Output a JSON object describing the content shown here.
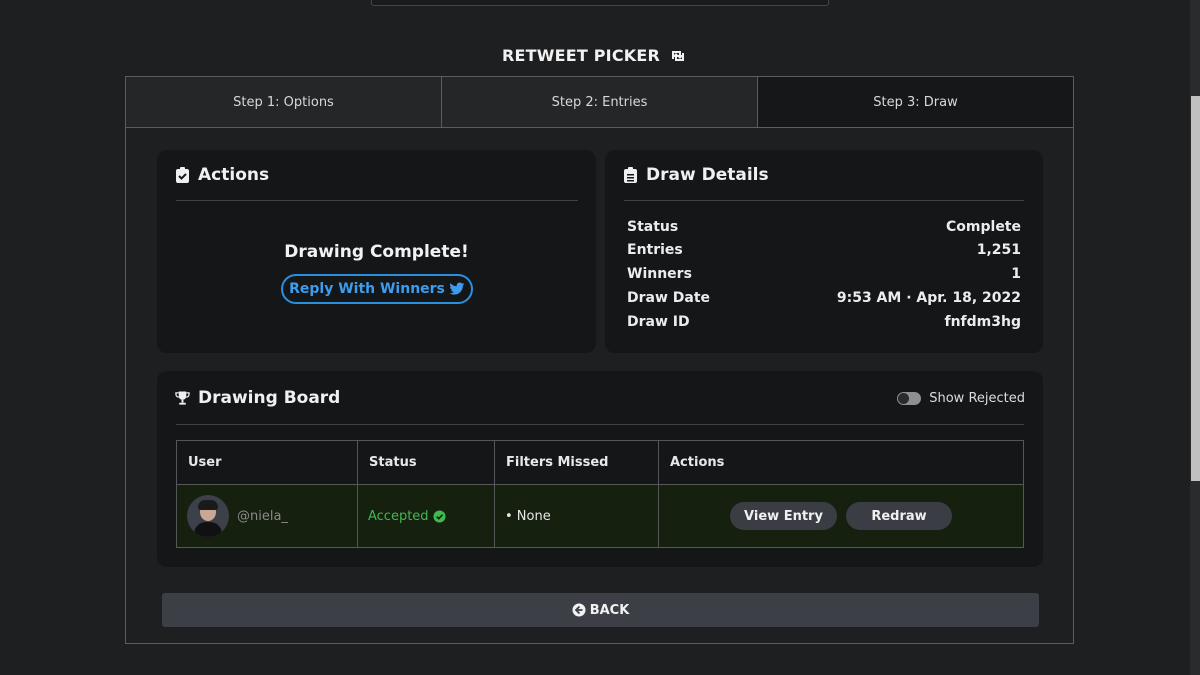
{
  "page_title": "RETWEET PICKER",
  "tabs": [
    "Step 1: Options",
    "Step 2: Entries",
    "Step 3: Draw"
  ],
  "actions": {
    "title": "Actions",
    "message": "Drawing Complete!",
    "reply_button": "Reply With Winners"
  },
  "details": {
    "title": "Draw Details",
    "rows": [
      {
        "label": "Status",
        "value": "Complete"
      },
      {
        "label": "Entries",
        "value": "1,251"
      },
      {
        "label": "Winners",
        "value": "1"
      },
      {
        "label": "Draw Date",
        "value": "9:53 AM · Apr. 18, 2022"
      },
      {
        "label": "Draw ID",
        "value": "fnfdm3hg"
      }
    ]
  },
  "board": {
    "title": "Drawing Board",
    "toggle_label": "Show Rejected",
    "columns": [
      "User",
      "Status",
      "Filters Missed",
      "Actions"
    ],
    "rows": [
      {
        "user": "@niela_",
        "status": "Accepted",
        "filters": "• None",
        "view_button": "View Entry",
        "redraw_button": "Redraw"
      }
    ]
  },
  "back_button": "BACK",
  "colors": {
    "accent": "#2b8fe0",
    "accepted": "#3fb950",
    "background": "#1e1f21",
    "card": "#151617"
  },
  "icons": {
    "title": "retweet-icon",
    "actions": "clipboard-check-icon",
    "details": "clipboard-list-icon",
    "board": "trophy-icon",
    "reply": "twitter-icon",
    "accepted": "check-circle-icon",
    "back": "arrow-circle-left-icon"
  }
}
